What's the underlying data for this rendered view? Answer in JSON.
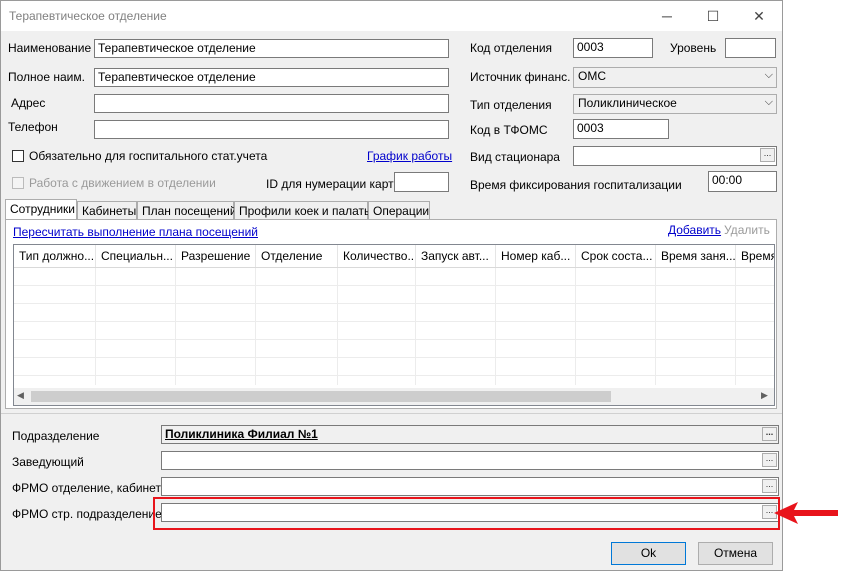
{
  "window": {
    "title": "Терапевтическое отделение",
    "minimize": "─",
    "maximize": "☐",
    "close": "✕"
  },
  "left_fields": {
    "name_label": "Наименование",
    "name_value": "Терапевтическое отделение",
    "fullname_label": "Полное наим.",
    "fullname_value": "Терапевтическое отделение",
    "address_label": "Адрес",
    "address_value": "",
    "phone_label": "Телефон",
    "phone_value": ""
  },
  "right_fields": {
    "code_label": "Код отделения",
    "code_value": "0003",
    "level_label": "Уровень",
    "level_value": "",
    "finance_label": "Источник финанс.",
    "finance_value": "ОМС",
    "dept_type_label": "Тип отделения",
    "dept_type_value": "Поликлиническое",
    "tfoms_label": "Код в ТФОМС",
    "tfoms_value": "0003",
    "stationary_label": "Вид стационара",
    "stationary_value": "",
    "fix_time_label": "Время фиксирования госпитализации",
    "fix_time_value": "00:00"
  },
  "checks": {
    "mandatory_label": "Обязательно для госпитального стат.учета",
    "mandatory_checked": false,
    "movement_label": "Работа с движением в отделении",
    "movement_checked": false
  },
  "schedule_link": "График работы",
  "id_cards_label": "ID для нумерации карт",
  "id_cards_value": "",
  "tabs": [
    {
      "label": "Сотрудники",
      "active": true
    },
    {
      "label": "Кабинеты",
      "active": false
    },
    {
      "label": "План посещений",
      "active": false
    },
    {
      "label": "Профили коек и палаты",
      "active": false
    },
    {
      "label": "Операции",
      "active": false
    }
  ],
  "panel": {
    "recalc_link": "Пересчитать выполнение плана посещений",
    "add_link": "Добавить",
    "delete_label": "Удалить",
    "columns": [
      "Тип должно...",
      "Специальн...",
      "Разрешение",
      "Отделение",
      "Количество...",
      "Запуск авт...",
      "Номер каб...",
      "Срок соста...",
      "Время заня...",
      "Время"
    ],
    "scroll_left": "◀",
    "scroll_right": "▶"
  },
  "bottom": {
    "subdivision_label": "Подразделение",
    "subdivision_value": "Поликлиника Филиал №1",
    "head_label": "Заведующий",
    "head_value": "",
    "frmo_cab_label": "ФРМО отделение, кабинет",
    "frmo_cab_value": "",
    "frmo_sub_label": "ФРМО стр. подразделение",
    "frmo_sub_value": "",
    "dots": "..."
  },
  "buttons": {
    "ok": "Ok",
    "cancel": "Отмена"
  },
  "annotation": {
    "color": "#e8141b"
  }
}
